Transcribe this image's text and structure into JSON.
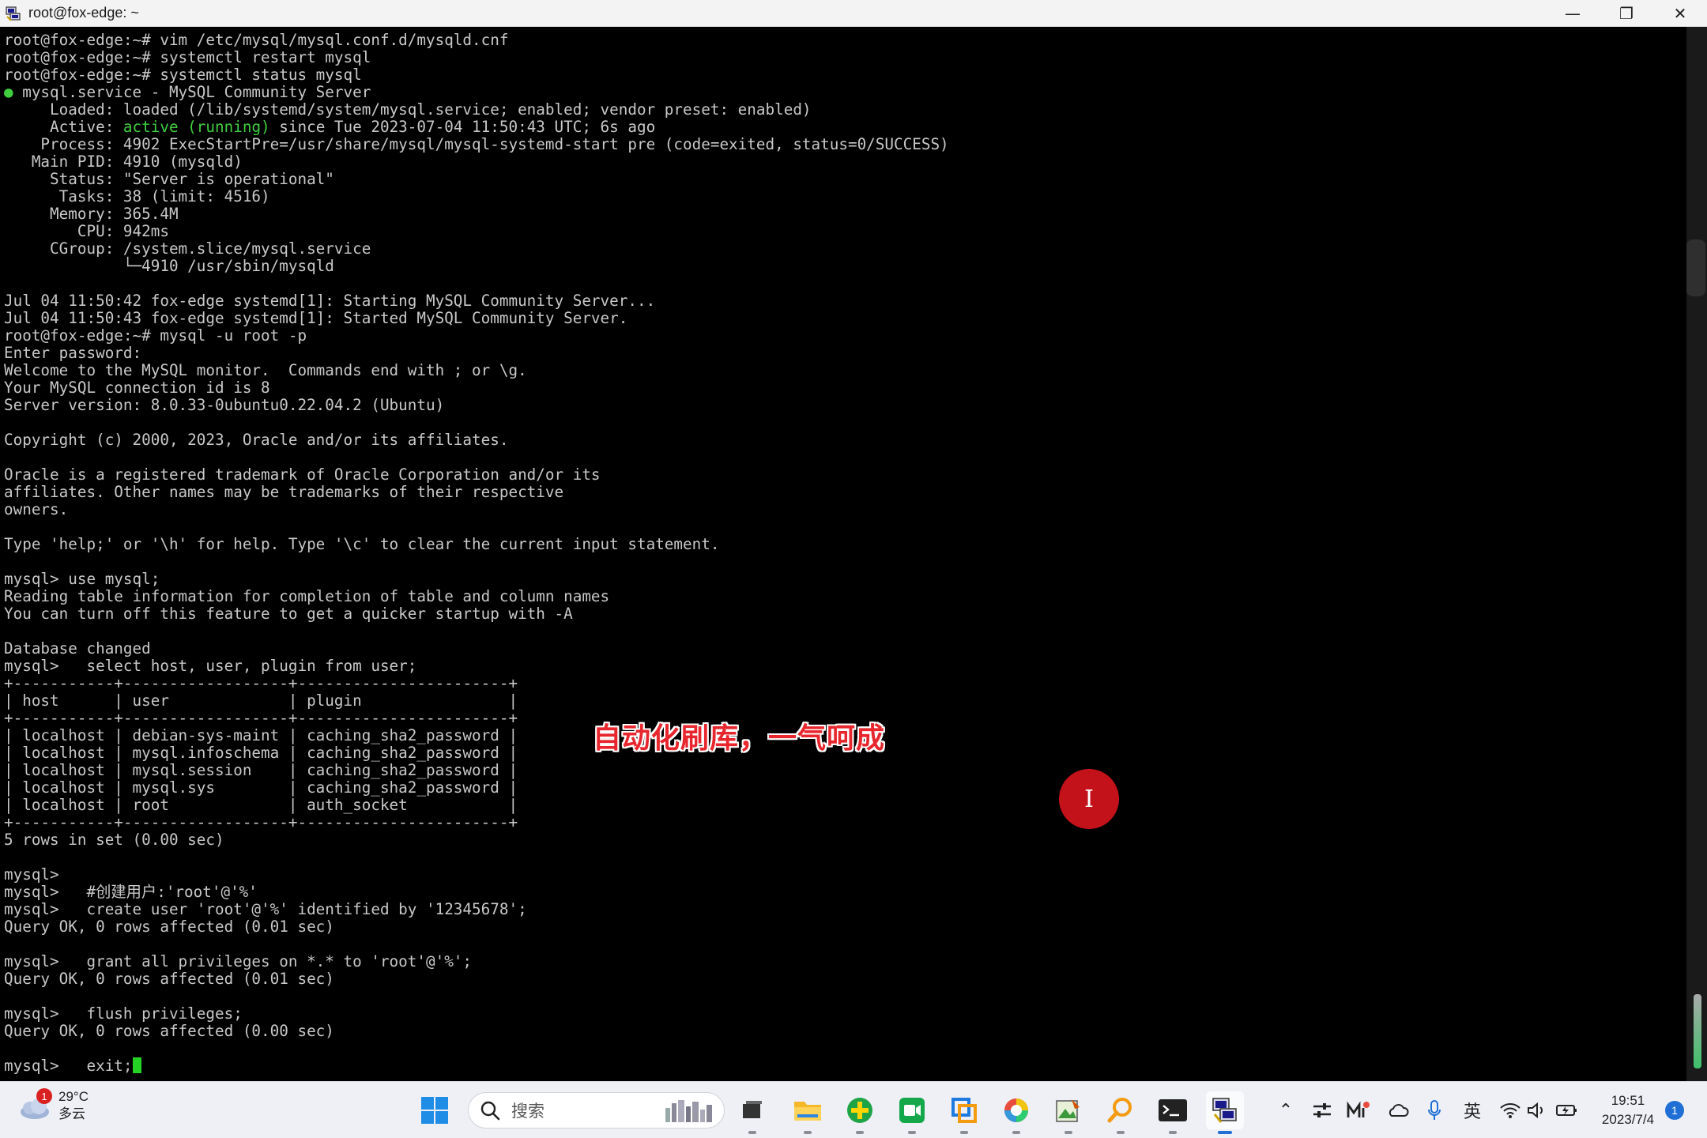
{
  "window": {
    "title": "root@fox-edge: ~",
    "minimize_glyph": "—",
    "restore_glyph": "❐",
    "close_glyph": "✕"
  },
  "terminal": {
    "lines_before_active": [
      "root@fox-edge:~# vim /etc/mysql/mysql.conf.d/mysqld.cnf",
      "root@fox-edge:~# systemctl restart mysql",
      "root@fox-edge:~# systemctl status mysql"
    ],
    "service_bullet": "●",
    "service_line": " mysql.service - MySQL Community Server",
    "loaded_line": "     Loaded: loaded (/lib/systemd/system/mysql.service; enabled; vendor preset: enabled)",
    "active_prefix": "     Active: ",
    "active_status": "active (running)",
    "active_suffix": " since Tue 2023-07-04 11:50:43 UTC; 6s ago",
    "lines_after_active": [
      "    Process: 4902 ExecStartPre=/usr/share/mysql/mysql-systemd-start pre (code=exited, status=0/SUCCESS)",
      "   Main PID: 4910 (mysqld)",
      "     Status: \"Server is operational\"",
      "      Tasks: 38 (limit: 4516)",
      "     Memory: 365.4M",
      "        CPU: 942ms",
      "     CGroup: /system.slice/mysql.service",
      "             └─4910 /usr/sbin/mysqld",
      "",
      "Jul 04 11:50:42 fox-edge systemd[1]: Starting MySQL Community Server...",
      "Jul 04 11:50:43 fox-edge systemd[1]: Started MySQL Community Server.",
      "root@fox-edge:~# mysql -u root -p",
      "Enter password:",
      "Welcome to the MySQL monitor.  Commands end with ; or \\g.",
      "Your MySQL connection id is 8",
      "Server version: 8.0.33-0ubuntu0.22.04.2 (Ubuntu)",
      "",
      "Copyright (c) 2000, 2023, Oracle and/or its affiliates.",
      "",
      "Oracle is a registered trademark of Oracle Corporation and/or its",
      "affiliates. Other names may be trademarks of their respective",
      "owners.",
      "",
      "Type 'help;' or '\\h' for help. Type '\\c' to clear the current input statement.",
      "",
      "mysql> use mysql;",
      "Reading table information for completion of table and column names",
      "You can turn off this feature to get a quicker startup with -A",
      "",
      "Database changed",
      "mysql>   select host, user, plugin from user;",
      "+-----------+------------------+-----------------------+",
      "| host      | user             | plugin                |",
      "+-----------+------------------+-----------------------+",
      "| localhost | debian-sys-maint | caching_sha2_password |",
      "| localhost | mysql.infoschema | caching_sha2_password |",
      "| localhost | mysql.session    | caching_sha2_password |",
      "| localhost | mysql.sys        | caching_sha2_password |",
      "| localhost | root             | auth_socket           |",
      "+-----------+------------------+-----------------------+",
      "5 rows in set (0.00 sec)",
      "",
      "mysql>",
      "mysql>   #创建用户:'root'@'%'",
      "mysql>   create user 'root'@'%' identified by '12345678';",
      "Query OK, 0 rows affected (0.01 sec)",
      "",
      "mysql>   grant all privileges on *.* to 'root'@'%';",
      "Query OK, 0 rows affected (0.01 sec)",
      "",
      "mysql>   flush privileges;",
      "Query OK, 0 rows affected (0.00 sec)",
      ""
    ],
    "current_prompt": "mysql>   exit;"
  },
  "overlay": {
    "caption": "自动化刷库，一气呵成",
    "cursor_glyph": "I"
  },
  "taskbar": {
    "weather_badge": "1",
    "temperature": "29°C",
    "condition": "多云",
    "search_placeholder": "搜索",
    "apps": [
      "file-explorer",
      "folder",
      "plus-app",
      "video-app",
      "remote-app",
      "browser",
      "image-editor",
      "search-tool",
      "terminal",
      "putty"
    ],
    "ime_label": "英",
    "time": "19:51",
    "date": "2023/7/4",
    "notification_count": "1"
  }
}
